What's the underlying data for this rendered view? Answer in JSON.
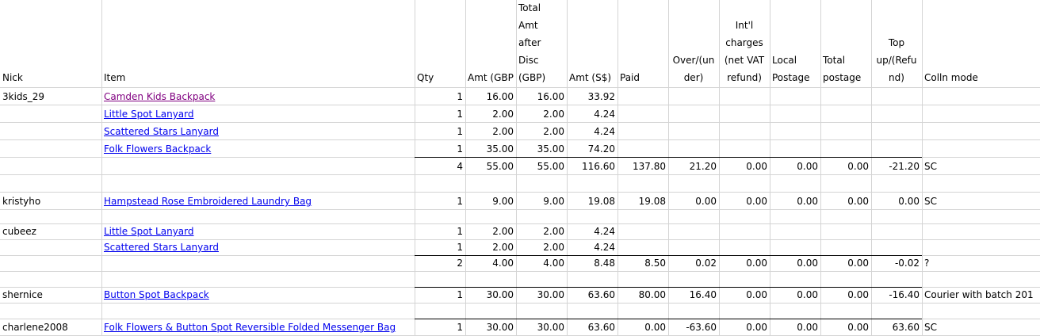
{
  "headers": {
    "nick": "Nick",
    "item": "Item",
    "qty": "Qty",
    "amt_gbp": "Amt (GBP",
    "total_amt": "Total\nAmt\nafter\nDisc\n(GBP)",
    "amt_sgd": "Amt (S$)",
    "paid": "Paid",
    "over_under": "Over/(un\nder)",
    "intl_charges": "Int'l\ncharges\n(net VAT\nrefund)",
    "local_postage": "Local\nPostage",
    "total_postage": "Total\npostage",
    "topup": "Top\nup/(Refu\nnd)",
    "colln_mode": "Colln mode"
  },
  "rows": [
    {
      "nick": "3kids_29",
      "item": "Camden Kids Backpack",
      "link": "visited",
      "qty": "1",
      "amt_gbp": "16.00",
      "total_amt": "16.00",
      "amt_sgd": "33.92"
    },
    {
      "item": "Little Spot Lanyard",
      "link": "link",
      "qty": "1",
      "amt_gbp": "2.00",
      "total_amt": "2.00",
      "amt_sgd": "4.24"
    },
    {
      "item": "Scattered Stars Lanyard",
      "link": "link",
      "qty": "1",
      "amt_gbp": "2.00",
      "total_amt": "2.00",
      "amt_sgd": "4.24"
    },
    {
      "item": "Folk Flowers Backpack",
      "link": "link",
      "qty": "1",
      "amt_gbp": "35.00",
      "total_amt": "35.00",
      "amt_sgd": "74.20"
    },
    {
      "qty": "4",
      "amt_gbp": "55.00",
      "total_amt": "55.00",
      "amt_sgd": "116.60",
      "paid": "137.80",
      "over_under": "21.20",
      "intl_charges": "0.00",
      "local_postage": "0.00",
      "total_postage": "0.00",
      "topup": "-21.20",
      "colln_mode": "SC"
    },
    {},
    {
      "nick": "kristyho",
      "item": "Hampstead Rose Embroidered Laundry Bag",
      "link": "link",
      "qty": "1",
      "amt_gbp": "9.00",
      "total_amt": "9.00",
      "amt_sgd": "19.08",
      "paid": "19.08",
      "over_under": "0.00",
      "intl_charges": "0.00",
      "local_postage": "0.00",
      "total_postage": "0.00",
      "topup": "0.00",
      "colln_mode": "SC"
    },
    {},
    {
      "nick": "cubeez",
      "item": "Little Spot Lanyard",
      "link": "link",
      "qty": "1",
      "amt_gbp": "2.00",
      "total_amt": "2.00",
      "amt_sgd": "4.24"
    },
    {
      "item": "Scattered Stars Lanyard",
      "link": "link",
      "qty": "1",
      "amt_gbp": "2.00",
      "total_amt": "2.00",
      "amt_sgd": "4.24"
    },
    {
      "qty": "2",
      "amt_gbp": "4.00",
      "total_amt": "4.00",
      "amt_sgd": "8.48",
      "paid": "8.50",
      "over_under": "0.02",
      "intl_charges": "0.00",
      "local_postage": "0.00",
      "total_postage": "0.00",
      "topup": "-0.02",
      "colln_mode": "?"
    },
    {},
    {
      "nick": "shernice",
      "item": "Button Spot Backpack",
      "link": "link",
      "qty": "1",
      "amt_gbp": "30.00",
      "total_amt": "30.00",
      "amt_sgd": "63.60",
      "paid": "80.00",
      "over_under": "16.40",
      "intl_charges": "0.00",
      "local_postage": "0.00",
      "total_postage": "0.00",
      "topup": "-16.40",
      "colln_mode": "Courier with batch 201"
    },
    {},
    {
      "nick": "charlene2008",
      "item": "Folk Flowers & Button Spot Reversible Folded Messenger Bag",
      "link": "link",
      "qty": "1",
      "amt_gbp": "30.00",
      "total_amt": "30.00",
      "amt_sgd": "63.60",
      "paid": "0.00",
      "over_under": "-63.60",
      "intl_charges": "0.00",
      "local_postage": "0.00",
      "total_postage": "0.00",
      "topup": "63.60",
      "colln_mode": "SC"
    }
  ]
}
